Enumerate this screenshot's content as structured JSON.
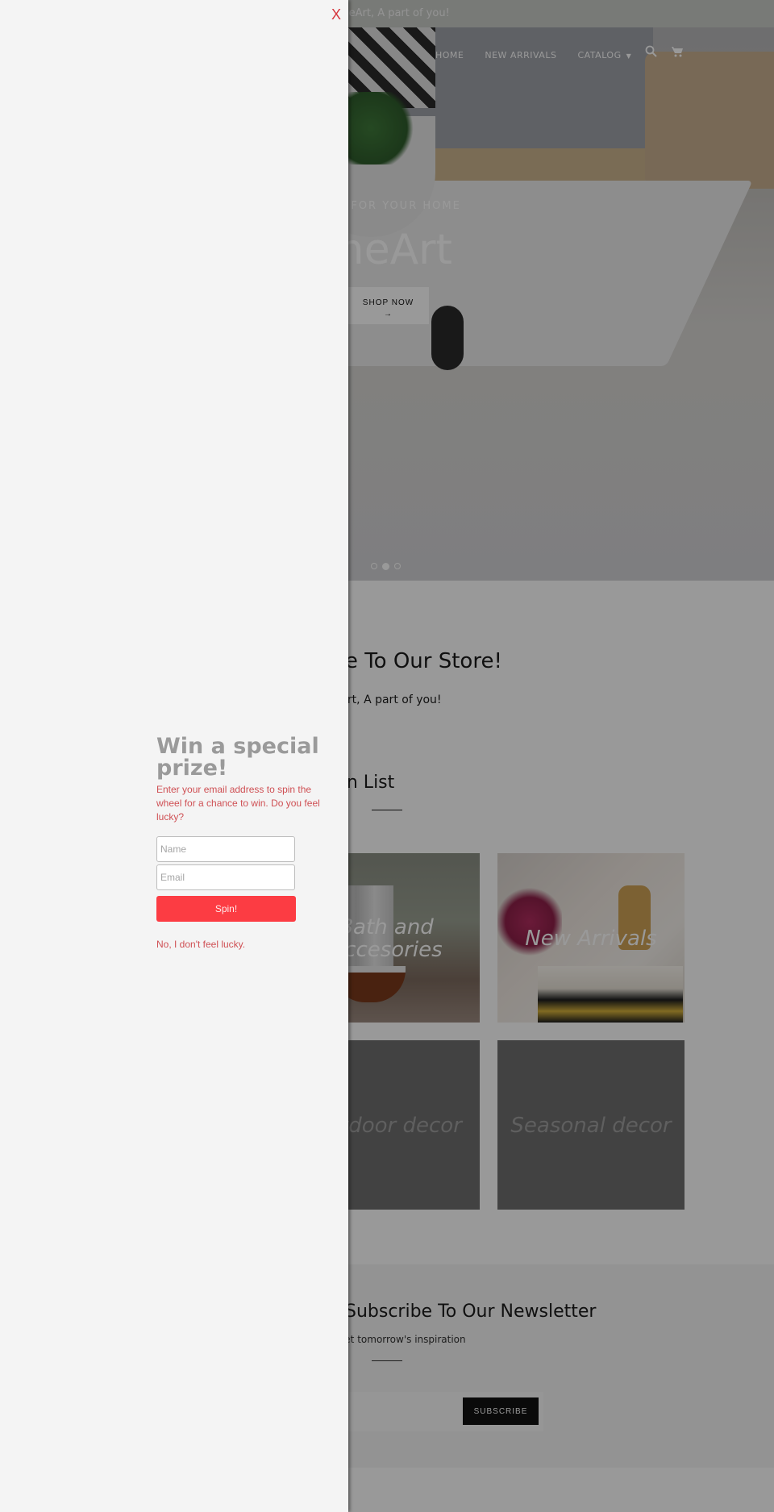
{
  "store": {
    "announcement": "HomeArt, A part of you!",
    "nav": {
      "items": [
        {
          "label": "HOME"
        },
        {
          "label": "NEW ARRIVALS"
        },
        {
          "label": "CATALOG",
          "has_dropdown": true
        }
      ],
      "icons": [
        "search-icon",
        "cart-icon"
      ]
    },
    "hero": {
      "subheading": "IDEAS FOR YOUR HOME",
      "title": "HomeArt",
      "button_label": "SHOP NOW",
      "button_arrow": "→",
      "slides_total": 3,
      "active_slide": 2
    },
    "welcome": {
      "title": "Welcome To Our Store!",
      "subtitle": "HomeArt, A part of you!"
    },
    "collections": {
      "title": "Collection List",
      "items": [
        {
          "label": "Bath and Accesories"
        },
        {
          "label": "New Arrivals"
        },
        {
          "label": "Outdoor decor"
        },
        {
          "label": "Seasonal decor"
        }
      ]
    },
    "newsletter": {
      "title": "Subscribe To Our Newsletter",
      "subtitle": "Get tomorrow's inspiration",
      "email_placeholder": "",
      "button_label": "SUBSCRIBE"
    }
  },
  "prize_panel": {
    "close_label": "X",
    "title": "Win a special prize!",
    "description": "Enter your email address to spin the wheel for a chance to win. Do you feel lucky?",
    "name_placeholder": "Name",
    "email_placeholder": "Email",
    "spin_label": "Spin!",
    "decline_label": "No, I don't feel lucky."
  },
  "colors": {
    "accent_red": "#fc3c43",
    "text_red": "#cf5054",
    "close_red": "#d6363d",
    "panel_bg": "#f4f4f4",
    "title_gray": "#9a9a9a"
  }
}
